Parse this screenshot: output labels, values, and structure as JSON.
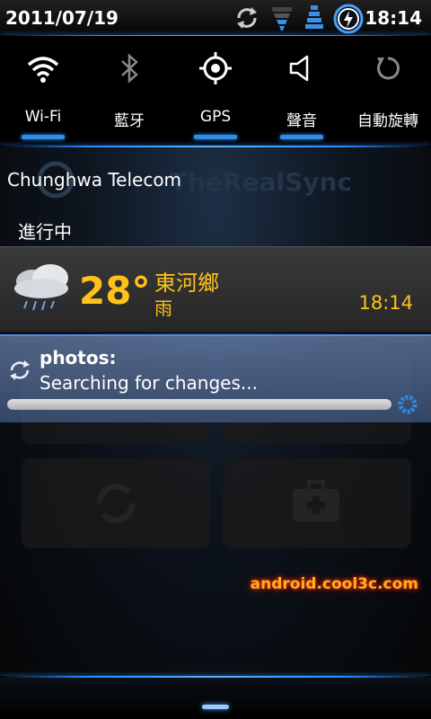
{
  "status_bar": {
    "date": "2011/07/19",
    "time": "18:14",
    "icons": [
      "sync-icon",
      "wifi-signal-icon",
      "cell-signal-icon",
      "battery-charging-icon"
    ]
  },
  "toggles": [
    {
      "label": "Wi-Fi",
      "icon": "wifi-icon",
      "active": true
    },
    {
      "label": "藍牙",
      "icon": "bluetooth-icon",
      "active": false
    },
    {
      "label": "GPS",
      "icon": "gps-icon",
      "active": true
    },
    {
      "label": "聲音",
      "icon": "speaker-icon",
      "active": true
    },
    {
      "label": "自動旋轉",
      "icon": "rotate-icon",
      "active": false
    }
  ],
  "carrier": "Chunghwa Telecom",
  "watermark": "TheRealSync",
  "ongoing_header": "進行中",
  "weather": {
    "temperature": "28°",
    "location": "東河鄉",
    "condition": "雨",
    "time": "18:14",
    "icon": "rain-cloud-icon"
  },
  "sync": {
    "title": "photos:",
    "message": "Searching for changes...",
    "progress": 1.0,
    "icon": "sync-icon"
  },
  "site_watermark": "android.cool3c.com",
  "colors": {
    "accent": "#2f8de6",
    "weather_text": "#ffc21a"
  }
}
